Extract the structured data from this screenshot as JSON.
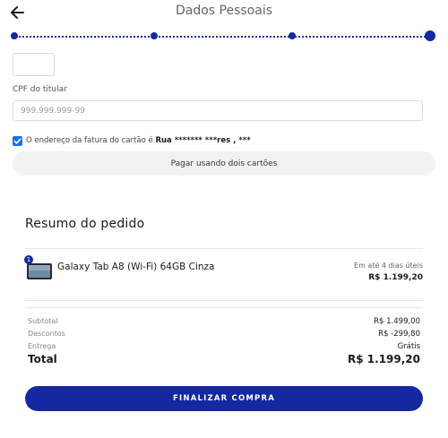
{
  "header": {
    "title": "Dados Pessoais",
    "back_icon": "arrow-left-icon"
  },
  "stepper": {
    "steps": 4,
    "current_step": 4,
    "accent_color": "#1428a0"
  },
  "form": {
    "cpf_label": "CPF do titular",
    "cpf_placeholder": "999.999.999-99",
    "billing_checkbox_checked": true,
    "billing_prefix": "O endereço da fatura do cartão é ",
    "billing_address": "Rua ******* ***res , ***",
    "two_cards_label": "Pagar usando dois cartões"
  },
  "summary": {
    "title": "Resumo do pedido",
    "item": {
      "quantity": "1",
      "name": "Galaxy Tab A8 (Wi-Fi) 64GB Cinza",
      "delivery": "Em até 4 dias úteis",
      "price": "R$ 1.199,20"
    },
    "rows": [
      {
        "label": "Subtotal",
        "value": "R$ 1.499,00"
      },
      {
        "label": "Descontos",
        "value": "R$ -299,80"
      },
      {
        "label": "Entrega",
        "value": "Grátis"
      }
    ],
    "total_label": "Total",
    "total_value": "R$ 1.199,20"
  },
  "checkout": {
    "label": "FINALIZAR COMPRA",
    "color": "#1428a0"
  }
}
